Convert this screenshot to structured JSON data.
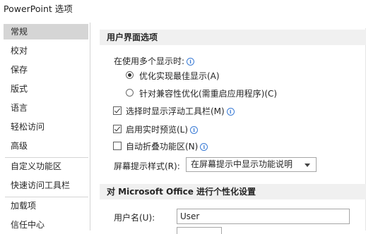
{
  "window": {
    "title": "PowerPoint 选项"
  },
  "nav": {
    "items": [
      {
        "label": "常规",
        "selected": true
      },
      {
        "label": "校对"
      },
      {
        "label": "保存"
      },
      {
        "label": "版式"
      },
      {
        "label": "语言"
      },
      {
        "label": "轻松访问"
      },
      {
        "label": "高级"
      },
      {
        "label": "自定义功能区"
      },
      {
        "label": "快速访问工具栏"
      },
      {
        "label": "加载项"
      },
      {
        "label": "信任中心"
      }
    ]
  },
  "ui_options": {
    "header": "用户界面选项",
    "multi_display_label": "在使用多个显示时:",
    "radio_optimize": {
      "label": "优化实现最佳显示(A)",
      "selected": true
    },
    "radio_compat": {
      "label": "针对兼容性优化(需重启应用程序)(C)",
      "selected": false
    },
    "mini_toolbar": {
      "label": "选择时显示浮动工具栏(M)",
      "checked": true
    },
    "live_preview": {
      "label": "启用实时预览(L)",
      "checked": true
    },
    "collapse_ribbon": {
      "label": "自动折叠功能区(N)",
      "checked": false
    },
    "screentip_label": "屏幕提示样式(R):",
    "screentip_value": "在屏幕提示中显示功能说明"
  },
  "personalize": {
    "header": "对 Microsoft Office 进行个性化设置",
    "username_label": "用户名(U):",
    "username_value": "User"
  }
}
